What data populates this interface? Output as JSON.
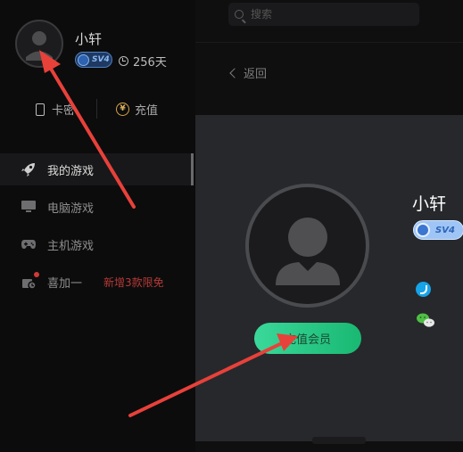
{
  "profile": {
    "username": "小轩",
    "level_badge": "SV4",
    "days": "256天"
  },
  "quick_actions": {
    "card_label": "卡密",
    "recharge_label": "充值"
  },
  "sidebar": {
    "items": [
      {
        "label": "我的游戏",
        "icon": "rocket-icon",
        "active": true
      },
      {
        "label": "电脑游戏",
        "icon": "monitor-icon"
      },
      {
        "label": "主机游戏",
        "icon": "gamepad-icon"
      },
      {
        "label": "喜加一",
        "icon": "gift-icon",
        "promo": "新增3款限免"
      }
    ]
  },
  "header": {
    "search_placeholder": "搜索",
    "back_label": "返回"
  },
  "panel": {
    "username": "小轩",
    "level_badge": "SV4",
    "vip_button": "充值会员",
    "contacts": [
      "qq-icon",
      "wechat-icon"
    ]
  },
  "colors": {
    "accent_green": "#1fc07f",
    "promo_red": "#b63a36",
    "annotation_red": "#e8413a"
  }
}
